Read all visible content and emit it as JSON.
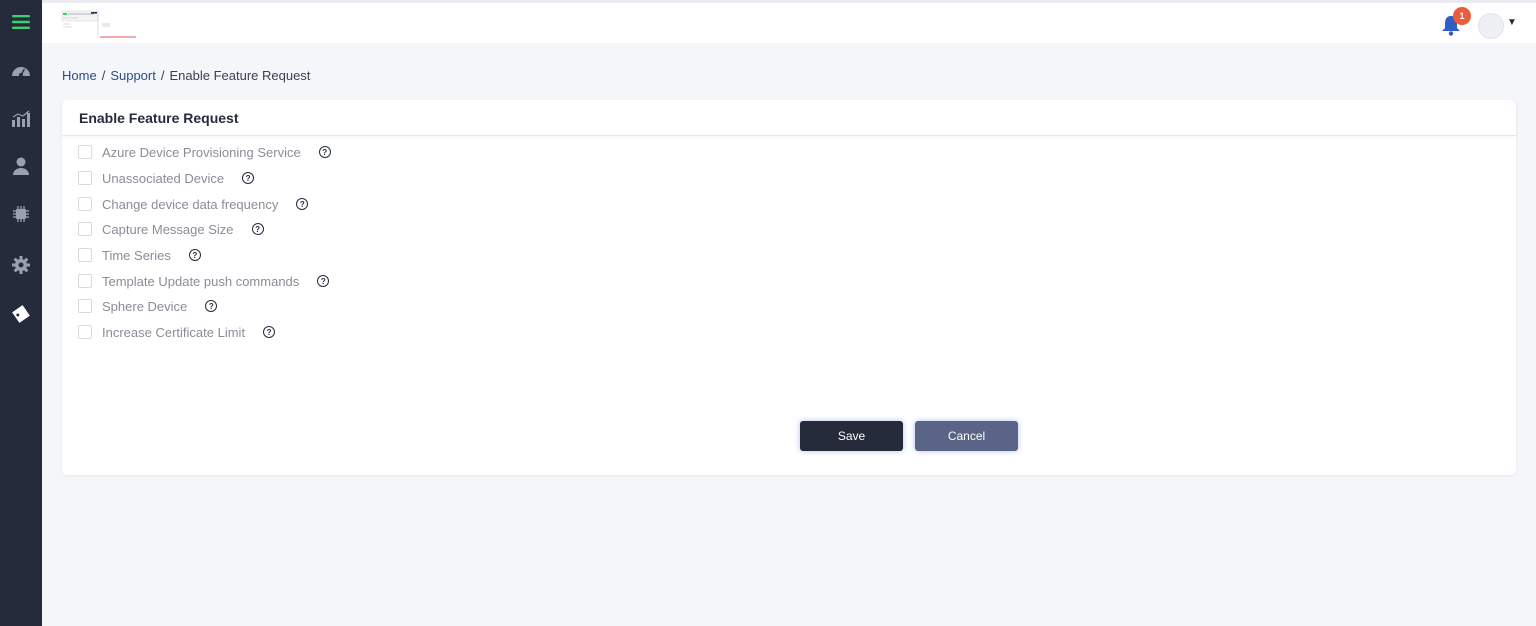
{
  "sidebar": {
    "items": [
      {
        "icon": "hamburger-menu-icon",
        "color": "#3ecf6e"
      },
      {
        "icon": "dashboard-gauge-icon"
      },
      {
        "icon": "analytics-chart-icon"
      },
      {
        "icon": "user-icon"
      },
      {
        "icon": "chip-icon"
      },
      {
        "icon": "gear-icon"
      },
      {
        "icon": "ticket-icon"
      }
    ]
  },
  "header": {
    "notification_count": "1",
    "badge_color": "#f05a3c"
  },
  "breadcrumb": {
    "home": "Home",
    "support": "Support",
    "current": "Enable Feature Request",
    "separator": "/"
  },
  "card": {
    "title": "Enable Feature Request",
    "options": [
      {
        "label": "Azure Device Provisioning Service",
        "checked": false
      },
      {
        "label": "Unassociated Device",
        "checked": false
      },
      {
        "label": "Change device data frequency",
        "checked": false
      },
      {
        "label": "Capture Message Size",
        "checked": false
      },
      {
        "label": "Time Series",
        "checked": false
      },
      {
        "label": "Template Update push commands",
        "checked": false
      },
      {
        "label": "Sphere Device",
        "checked": false
      },
      {
        "label": "Increase Certificate Limit",
        "checked": false
      }
    ],
    "help_glyph": "?"
  },
  "actions": {
    "save_label": "Save",
    "cancel_label": "Cancel"
  }
}
